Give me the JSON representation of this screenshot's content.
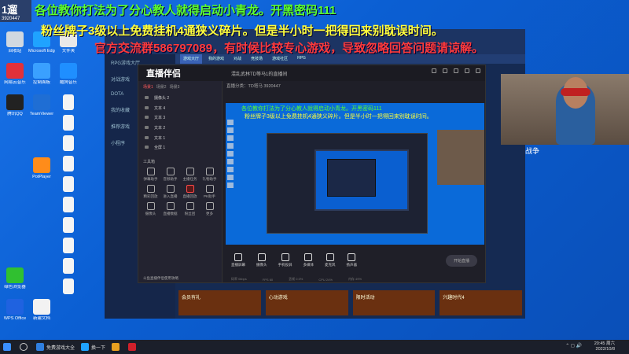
{
  "corner": {
    "title": "1遛",
    "code": "3920447"
  },
  "overlays": {
    "line1": "各位教你打法为了分心教人就得启动小青龙。开黑密码111",
    "line2": "粉丝牌子3级以上免费挂机4通狭义碎片。但是半小时一把得回来别耽误时间。",
    "line3": "官方交流群586797089，有时候比较专心游戏，导致忽略回答问题请谅解。"
  },
  "desktop_icons": [
    {
      "label": "回收站",
      "color": "#d0d8e0"
    },
    {
      "label": "Microsoft Edge",
      "color": "#1fa3ff"
    },
    {
      "label": "网易云音乐",
      "color": "#e0313a"
    },
    {
      "label": "控制面板",
      "color": "#3aa0ff"
    },
    {
      "label": "腾讯QQ",
      "color": "#222"
    },
    {
      "label": "TeamViewer",
      "color": "#1f6ed4"
    },
    {
      "label": "文件夹",
      "color": "#e8e8e8"
    },
    {
      "label": "酷狗音乐",
      "color": "#1f8fff"
    },
    {
      "label": "PotPlayer",
      "color": "#ff8c1a"
    },
    {
      "label": "绿色浏览器",
      "color": "#30c030"
    },
    {
      "label": "WPS Office",
      "color": "#1f62e0"
    },
    {
      "label": "新建文档",
      "color": "#f2f2f2"
    }
  ],
  "game_window": {
    "tabs": [
      "游戏大厅",
      "我的游戏",
      "对战",
      "竞技场",
      "游戏社区",
      "RPG"
    ],
    "side": [
      "RPG游戏大厅",
      "对战游戏",
      "DOTA",
      "我的收藏",
      "推荐游戏",
      "小程序"
    ],
    "cards": [
      "会员有礼",
      "心动游戏",
      "限时活动",
      "兴趣时代4"
    ]
  },
  "zb": {
    "logo": "直播伴侣",
    "title": "混乱武林TD等马1的直播间",
    "info": "直播分类：TD塔马  3920447",
    "left_tabs": [
      "场景1",
      "场景2",
      "场景3"
    ],
    "sources": [
      "摄像头 2",
      "文本 4",
      "文本 3",
      "文本 2",
      "文本 1",
      "全屏 1"
    ],
    "tools_title": "工具箱",
    "tools": [
      "弹幕助手",
      "音频助手",
      "主播任务",
      "礼物助手",
      "精彩回放",
      "进入直播",
      "直播回放",
      "PK助手",
      "摄像头",
      "直播数据",
      "粉丝团",
      "更多"
    ],
    "bottom_buttons": [
      "直播屏幕",
      "摄像头",
      "手机投屏",
      "多媒体",
      "麦克风",
      "扬声器"
    ],
    "start": "开始直播",
    "status": [
      "码率 0kbps",
      "FPS 60",
      "丢帧 0.0%",
      "CPU 24%",
      "内存 49%"
    ],
    "bottom_left": "斗鱼直播伴侣使用攻略"
  },
  "right_text": "战争",
  "taskbar": {
    "items": [
      {
        "label": "免费游戏大全",
        "color": "#2f7fe0"
      },
      {
        "label": "换一下",
        "color": "#1fa3ff"
      },
      {
        "label": "",
        "color": "#e8a020"
      },
      {
        "label": "",
        "color": "#d0202a"
      }
    ],
    "time": "20:45 周六",
    "date": "2022/10/8"
  }
}
